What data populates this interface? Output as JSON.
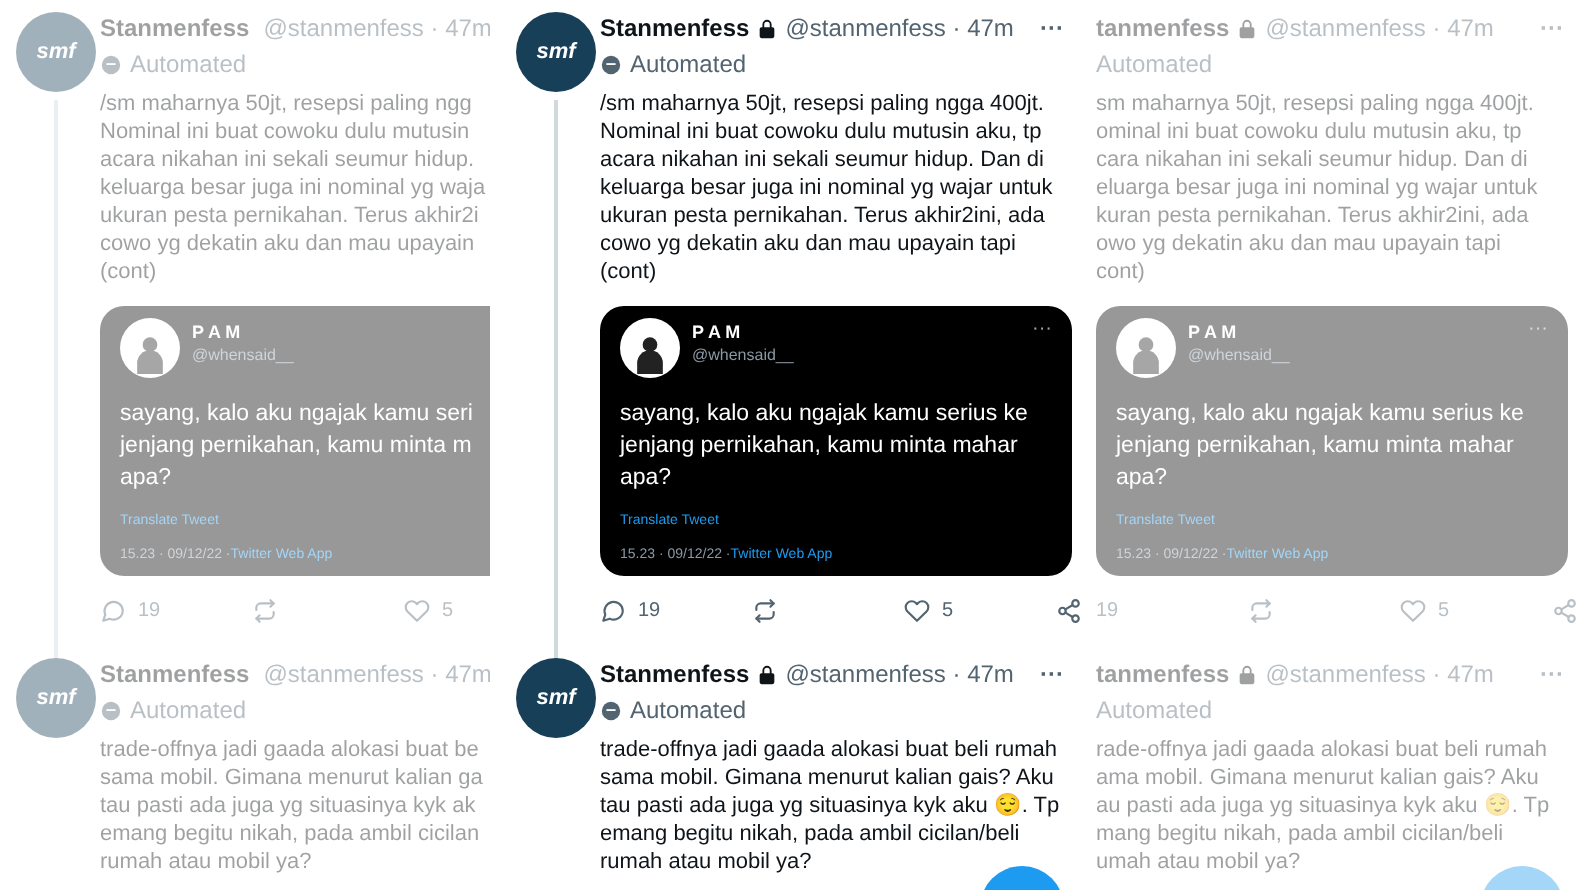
{
  "panels": [
    {
      "kind": "left",
      "faded": true,
      "tweets": [
        {
          "avatar_text": "smf",
          "name": "Stanmenfess",
          "handle": "@stanmenfess · 47m",
          "label": "Automated",
          "lines": [
            "/sm maharnya 50jt, resepsi paling ngg",
            "Nominal ini buat cowoku dulu mutusin",
            "acara nikahan ini sekali seumur hidup.",
            "keluarga besar juga ini nominal yg waja",
            "ukuran pesta pernikahan. Terus akhir2i",
            "cowo yg dekatin aku dan mau upayain",
            "(cont)"
          ],
          "quote": {
            "name": "P A M",
            "handle": "@whensaid__",
            "lines": [
              "sayang, kalo aku ngajak kamu seri",
              "jenjang pernikahan, kamu minta m",
              "apa?"
            ],
            "translate": "Translate Tweet",
            "time": "15.23 · 09/12/22 · ",
            "source": "Twitter Web App"
          },
          "replies": "19",
          "likes": "5"
        },
        {
          "avatar_text": "smf",
          "name": "Stanmenfess",
          "handle": "@stanmenfess · 47m",
          "label": "Automated",
          "lines": [
            "trade-offnya jadi gaada alokasi buat be",
            "sama mobil. Gimana menurut kalian ga",
            "tau pasti ada juga yg situasinya kyk ak",
            "emang begitu nikah, pada ambil cicilan",
            "rumah atau mobil ya?"
          ]
        }
      ]
    },
    {
      "kind": "center",
      "faded": false,
      "tweets": [
        {
          "avatar_text": "smf",
          "name": "Stanmenfess",
          "handle": "@stanmenfess · 47m",
          "more": "···",
          "label": "Automated",
          "lines": [
            "/sm maharnya 50jt, resepsi paling ngga 400jt.",
            "Nominal ini buat cowoku dulu mutusin aku, tp",
            "acara nikahan ini sekali seumur hidup. Dan di",
            "keluarga besar juga ini nominal yg wajar untuk",
            "ukuran pesta pernikahan. Terus akhir2ini, ada",
            "cowo yg dekatin aku dan mau upayain tapi",
            "(cont)"
          ],
          "quote": {
            "name": "P A M",
            "handle": "@whensaid__",
            "more": "···",
            "lines": [
              "sayang, kalo aku ngajak kamu serius ke",
              "jenjang pernikahan, kamu minta mahar",
              "apa?"
            ],
            "translate": "Translate Tweet",
            "time": "15.23 · 09/12/22 · ",
            "source": "Twitter Web App"
          },
          "replies": "19",
          "likes": "5"
        },
        {
          "avatar_text": "smf",
          "name": "Stanmenfess",
          "handle": "@stanmenfess · 47m",
          "more": "···",
          "label": "Automated",
          "lines": [
            "trade-offnya jadi gaada alokasi buat beli rumah",
            "sama mobil. Gimana menurut kalian gais? Aku",
            "tau pasti ada juga yg situasinya kyk aku 😌. Tp",
            "emang begitu nikah, pada ambil cicilan/beli",
            "rumah atau mobil ya?"
          ]
        }
      ]
    },
    {
      "kind": "right",
      "faded": true,
      "tweets": [
        {
          "name": "tanmenfess",
          "handle": "@stanmenfess · 47m",
          "more": "···",
          "label": "Automated",
          "lines": [
            "sm maharnya 50jt, resepsi paling ngga 400jt.",
            "ominal ini buat cowoku dulu mutusin aku, tp",
            "cara nikahan ini sekali seumur hidup. Dan di",
            "eluarga besar juga ini nominal yg wajar untuk",
            "kuran pesta pernikahan. Terus akhir2ini, ada",
            "owo yg dekatin aku dan mau upayain tapi",
            "cont)"
          ],
          "quote": {
            "name": "P A M",
            "handle": "@whensaid__",
            "more": "···",
            "lines": [
              "sayang, kalo aku ngajak kamu serius ke",
              "jenjang pernikahan, kamu minta mahar",
              "apa?"
            ],
            "translate": "Translate Tweet",
            "time": "15.23 · 09/12/22 · ",
            "source": "Twitter Web App"
          },
          "replies": "19",
          "likes": "5"
        },
        {
          "name": "tanmenfess",
          "handle": "@stanmenfess · 47m",
          "more": "···",
          "label": "Automated",
          "lines": [
            "rade-offnya jadi gaada alokasi buat beli rumah",
            "ama mobil. Gimana menurut kalian gais? Aku",
            "au pasti ada juga yg situasinya kyk aku 😌. Tp",
            "mang begitu nikah, pada ambil cicilan/beli",
            "umah atau mobil ya?"
          ]
        }
      ]
    }
  ]
}
